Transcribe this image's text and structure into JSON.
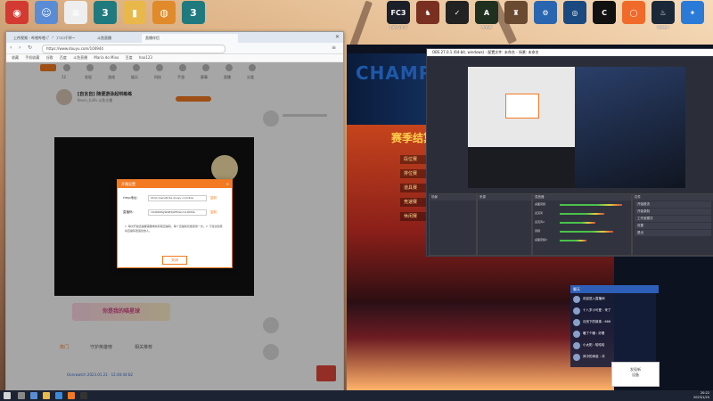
{
  "desktop": {
    "icons": [
      {
        "name": "netease-music",
        "label": "",
        "color": "#d33a31",
        "glyph": "◉"
      },
      {
        "name": "user-folder",
        "label": "",
        "color": "#5a8cd6",
        "glyph": "☺"
      },
      {
        "name": "document",
        "label": "",
        "color": "#eee",
        "glyph": "≡"
      },
      {
        "name": "3dsmax-a",
        "label": "",
        "color": "#1f7a7f",
        "glyph": "3"
      },
      {
        "name": "folder",
        "label": "",
        "color": "#e8b84a",
        "glyph": "▮"
      },
      {
        "name": "blender-like",
        "label": "",
        "color": "#e08a2a",
        "glyph": "◍"
      },
      {
        "name": "3dsmax-b",
        "label": "",
        "color": "#1f7a7f",
        "glyph": "3"
      }
    ],
    "right_icons": [
      {
        "name": "fc3",
        "label": "Far Cry 3",
        "color": "#1b1f28",
        "glyph": "FC3"
      },
      {
        "name": "game-2",
        "label": "",
        "color": "#7a3020",
        "glyph": "♞"
      },
      {
        "name": "game-3",
        "label": "",
        "color": "#222",
        "glyph": "✓"
      },
      {
        "name": "arma",
        "label": "ArmA",
        "color": "#203020",
        "glyph": "A"
      },
      {
        "name": "game-5",
        "label": "",
        "color": "#6a4a30",
        "glyph": "♜"
      },
      {
        "name": "control-panel",
        "label": "",
        "color": "#2a66b0",
        "glyph": "⚙"
      },
      {
        "name": "ubisoft",
        "label": "",
        "color": "#1a4a80",
        "glyph": "◎"
      },
      {
        "name": "app-yellow",
        "label": "",
        "color": "#111",
        "glyph": "C"
      },
      {
        "name": "origin",
        "label": "",
        "color": "#f06a2a",
        "glyph": "◯"
      },
      {
        "name": "steam",
        "label": "Steam",
        "color": "#1b2838",
        "glyph": "♨"
      },
      {
        "name": "epic-like",
        "label": "",
        "color": "#2a7ad8",
        "glyph": "✦"
      }
    ]
  },
  "browser": {
    "tabs": [
      "上传视频 - 哔哩哔哩 (゜-゜)つロ干杯~",
      "斗鱼直播",
      "直播伴侣"
    ],
    "address": "https://www.douyu.com/104944",
    "bookmarks": [
      "收藏",
      "手机收藏",
      "谷歌",
      "百度",
      "斗鱼直播",
      "Maria do Mixo",
      "百度",
      "hao123"
    ],
    "nav_items": [
      "12",
      "发现",
      "游戏",
      "娱乐",
      "科技",
      "手游",
      "赛事",
      "直播",
      "分类"
    ],
    "room_title": "[自言自] 随便游泳起哄练练",
    "room_sub": "Kevin_fuSh  斗鱼主播",
    "under_title": "你是我的喵星球",
    "under_tabs": [
      "热门",
      "守护英雄榜",
      "相关推荐"
    ],
    "under_stream": "Overwatch 2023.01.21 · 12:40:44:82"
  },
  "dialog": {
    "title": "开播设置",
    "row1_label": "rtmp地址:",
    "row1_value": "rtmp://sendtc3a.douyu.com/live",
    "row1_btn": "复制",
    "row2_label": "直播码:",
    "row2_value": "104944RgWsB3jGHDwx=e1694a",
    "row2_btn": "复制",
    "note": "1. 每次开始直播都需要重新获取直播码，每个直播码仅能使用一次。2. 不建议随意将直播码泄露给他人。",
    "ok": "关闭"
  },
  "game": {
    "logo": "CHAMPION",
    "menu": [
      "段位赛",
      "排位赛",
      "道具赛",
      "竞速赛",
      "休闲赛"
    ],
    "announce": "赛季结算"
  },
  "obs": {
    "title": "OBS 27.0.1 (64-bit, windows) - 配置文件: 未命名 - 场景: 未命名",
    "scenes_header": "场景",
    "sources_header": "来源",
    "mixer_header": "混音器",
    "mixer_rows": [
      "桌面音频",
      "麦克风",
      "麦克风2",
      "音频",
      "桌面音频2"
    ],
    "controls_header": "控件",
    "controls": [
      "开始推流",
      "开始录制",
      "工作室模式",
      "设置",
      "退出"
    ]
  },
  "chat": {
    "header": "聊天",
    "lines": [
      "欢迎进入直播间",
      "十八岁小可爱 : 来了",
      "月亮下的故事 : 666",
      "暖了个暖 : 好看",
      "小太阳 : 哈哈哈",
      "风中的承诺 : 冲"
    ]
  },
  "notice": {
    "line1": "发现新",
    "line2": "设备"
  },
  "clock": {
    "time": "20:22",
    "date": "2023/1/20"
  }
}
